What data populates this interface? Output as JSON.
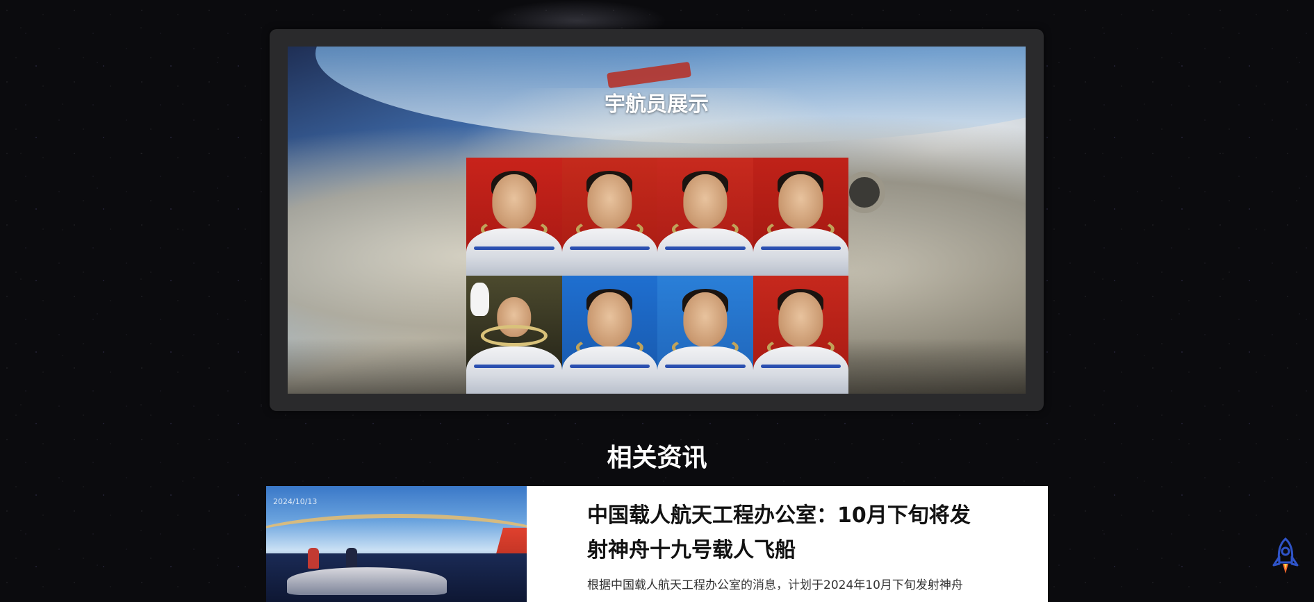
{
  "showcase": {
    "title": "宇航员展示"
  },
  "news": {
    "heading": "相关资讯",
    "items": [
      {
        "title": "中国载人航天工程办公室：10月下旬将发射神舟十九号载人飞船",
        "summary": "根据中国载人航天工程办公室的消息，计划于2024年10月下旬发射神舟",
        "thumb_caption": "2024/10/13"
      }
    ]
  },
  "colors": {
    "background": "#0b0b0e",
    "frame": "#2a2a2c",
    "card": "#ffffff",
    "rocket": "#2f54c8"
  },
  "icons": {
    "rocket": "rocket-icon"
  }
}
